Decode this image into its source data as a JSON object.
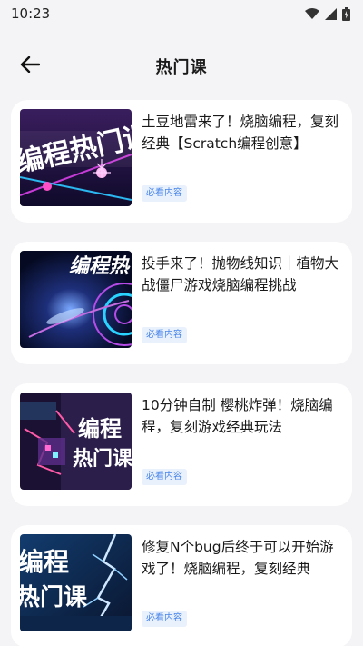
{
  "status_bar": {
    "time": "10:23",
    "icons": [
      "wifi-icon",
      "signal-icon",
      "battery-icon"
    ]
  },
  "header": {
    "title": "热门课",
    "back_icon": "back-arrow-icon"
  },
  "courses": [
    {
      "title": "土豆地雷来了！烧脑编程，复刻经典【Scratch编程创意】",
      "tag": "必看内容",
      "thumb_text": "编程热门课"
    },
    {
      "title": "投手来了！抛物线知识｜植物大战僵尸游戏烧脑编程挑战",
      "tag": "必看内容",
      "thumb_text": "编程热"
    },
    {
      "title": "10分钟自制 樱桃炸弹！烧脑编程，复刻游戏经典玩法",
      "tag": "必看内容",
      "thumb_text_1": "编程",
      "thumb_text_2": "热门课"
    },
    {
      "title": "修复N个bug后终于可以开始游戏了！烧脑编程，复刻经典",
      "tag": "必看内容",
      "thumb_text_1": "编程",
      "thumb_text_2": "热门课"
    }
  ],
  "colors": {
    "background": "#f4f4f6",
    "card": "#ffffff",
    "tag_text": "#4a86e8",
    "tag_bg": "#e9f1fd"
  }
}
